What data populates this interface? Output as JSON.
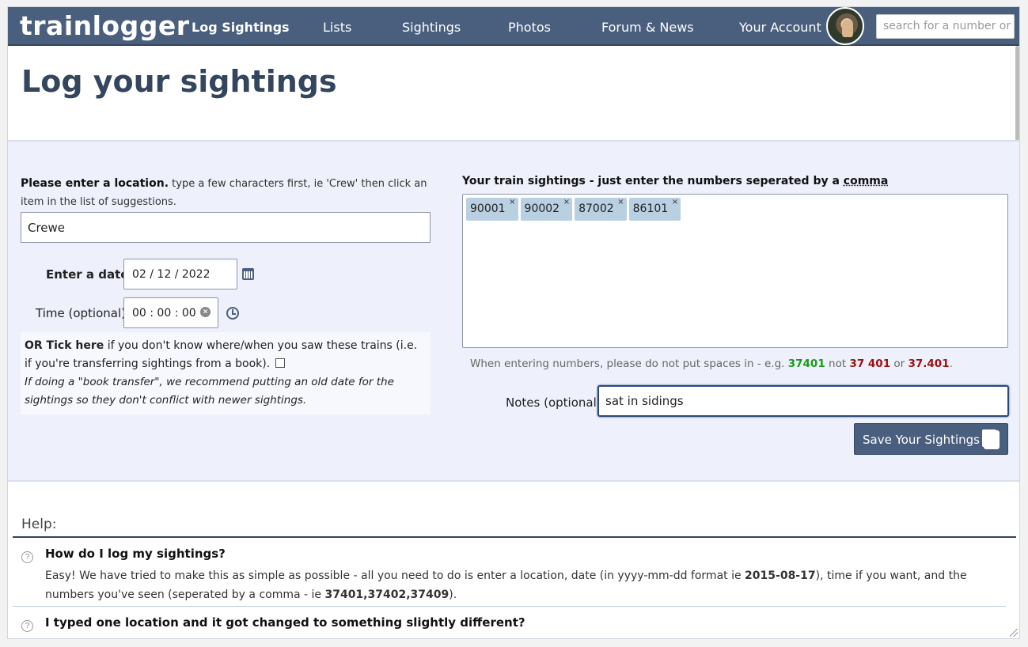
{
  "nav": {
    "logo": "trainlogger",
    "items": [
      "Log Sightings",
      "Lists",
      "Sightings",
      "Photos",
      "Forum & News",
      "Your Account"
    ],
    "search_placeholder": "search for a number or"
  },
  "page": {
    "title": "Log your sightings"
  },
  "form": {
    "location_label_bold": "Please enter a location.",
    "location_label_hint": "type a few characters first, ie 'Crew' then click an item in the list of suggestions.",
    "location_value": "Crewe",
    "date_label": "Enter a date",
    "date_value": "02 / 12 / 2022",
    "time_label": "Time (optional)",
    "time_value": "00 : 00 : 00",
    "book_bold": "OR Tick here",
    "book_text": "if you don't know where/when you saw these trains (i.e. if you're transferring sightings from a book).",
    "book_note": "If doing a \"book transfer\", we recommend putting an old date for the sightings so they don't conflict with newer sightings.",
    "sightings_label": "Your train sightings - just enter the numbers seperated by a",
    "sightings_label_word": "comma",
    "tags": [
      "90001",
      "90002",
      "87002",
      "86101"
    ],
    "hint_prefix": "When entering numbers, please do not put spaces in - e.g.",
    "hint_good": "37401",
    "hint_not": "not",
    "hint_bad1": "37 401",
    "hint_or": "or",
    "hint_bad2": "37.401",
    "notes_label": "Notes (optional)",
    "notes_value": "sat in sidings",
    "save_label": "Save Your Sightings"
  },
  "help": {
    "title": "Help:",
    "faq": [
      {
        "q": "How do I log my sightings?",
        "a_pre": "Easy! We have tried to make this as simple as possible - all you need to do is enter a location, date (in yyyy-mm-dd format ie",
        "a_date": "2015-08-17",
        "a_mid": "), time if you want, and the numbers you've seen (seperated by a comma - ie",
        "a_nums": "37401,37402,37409",
        "a_end": ")."
      },
      {
        "q": "I typed one location and it got changed to something slightly different?"
      }
    ]
  },
  "colors": {
    "nav": "#4a5f7e",
    "panel": "#eef0fb",
    "tag": "#b9cfe2",
    "good": "#1a9a1a",
    "bad": "#9b1010"
  }
}
